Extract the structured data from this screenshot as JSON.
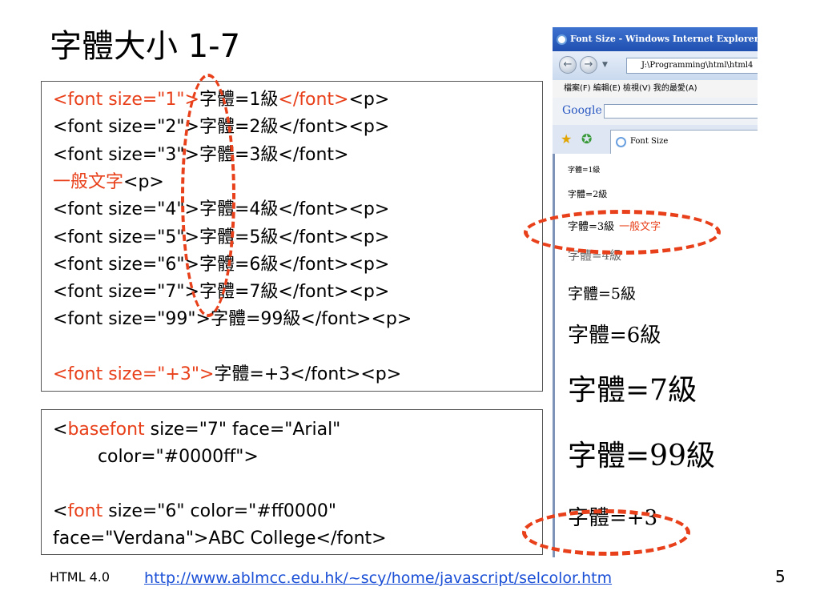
{
  "title": "字體大小 1-7",
  "code_block_1": {
    "lines": [
      {
        "segments": [
          {
            "text": "<font size=\"1\">",
            "red": true
          },
          {
            "text": "字體=1級",
            "red": false
          },
          {
            "text": "</font>",
            "red": true
          },
          {
            "text": "<p>",
            "red": false
          }
        ]
      },
      {
        "segments": [
          {
            "text": "<font size=\"2\">字體=2級</font><p>",
            "red": false
          }
        ]
      },
      {
        "segments": [
          {
            "text": "<font size=\"3\">字體=3級</font>",
            "red": false
          }
        ]
      },
      {
        "segments": [
          {
            "text": "一般文字",
            "red": true
          },
          {
            "text": "<p>",
            "red": false
          }
        ]
      },
      {
        "segments": [
          {
            "text": "<font size=\"4\">字體=4級</font><p>",
            "red": false
          }
        ]
      },
      {
        "segments": [
          {
            "text": "<font size=\"5\">字體=5級</font><p>",
            "red": false
          }
        ]
      },
      {
        "segments": [
          {
            "text": "<font size=\"6\">字體=6級</font><p>",
            "red": false
          }
        ]
      },
      {
        "segments": [
          {
            "text": "<font size=\"7\">字體=7級</font><p>",
            "red": false
          }
        ]
      },
      {
        "segments": [
          {
            "text": "<font size=\"99\">字體=99級</font><p>",
            "red": false
          }
        ]
      },
      {
        "segments": [
          {
            "text": "",
            "red": false
          }
        ]
      },
      {
        "segments": [
          {
            "text": "<font size=\"+3\">",
            "red": true
          },
          {
            "text": "字體=+3</font><p>",
            "red": false
          }
        ]
      }
    ]
  },
  "code_block_2": {
    "lines": [
      {
        "segments": [
          {
            "text": "<",
            "red": false
          },
          {
            "text": "basefont",
            "red": true
          },
          {
            "text": " size=\"7\" face=\"Arial\"",
            "red": false
          }
        ]
      },
      {
        "segments": [
          {
            "text": "        color=\"#0000ff\">",
            "red": false
          }
        ]
      },
      {
        "segments": [
          {
            "text": "",
            "red": false
          }
        ]
      },
      {
        "segments": [
          {
            "text": "<",
            "red": false
          },
          {
            "text": "font",
            "red": true
          },
          {
            "text": " size=\"6\" color=\"#ff0000\"",
            "red": false
          }
        ]
      },
      {
        "segments": [
          {
            "text": "face=\"Verdana\">ABC College</font>",
            "red": false
          }
        ]
      }
    ]
  },
  "browser": {
    "window_title": "Font Size - Windows Internet Explorer",
    "address": "J:\\Programming\\html\\html4",
    "menu": "檔案(F)   編輯(E)   檢視(V)   我的最愛(A)",
    "search_logo": "Google",
    "tab_title": "Font Size",
    "rendered_lines": [
      {
        "text": "字體=1級"
      },
      {
        "text": "字體=2級"
      },
      {
        "text": "字體=3級",
        "extra": "一般文字"
      },
      {
        "text": "字體=4級"
      },
      {
        "text": "字體=5級"
      },
      {
        "text": "字體=6級"
      },
      {
        "text": "字體=7級"
      },
      {
        "text": "字體=99級"
      },
      {
        "text": "字體=+3"
      }
    ]
  },
  "icons": {
    "ie": "ie-logo-icon",
    "back": "back-arrow-icon",
    "forward": "forward-arrow-icon",
    "favorites": "star-icon",
    "add_favorites": "add-favorite-icon"
  },
  "colors": {
    "accent_red": "#e8401a",
    "link_blue": "#1a4fd6"
  },
  "footer": {
    "left_label": "HTML 4.0",
    "link": "http://www.ablmcc.edu.hk/~scy/home/javascript/selcolor.htm",
    "page_number": "5"
  }
}
